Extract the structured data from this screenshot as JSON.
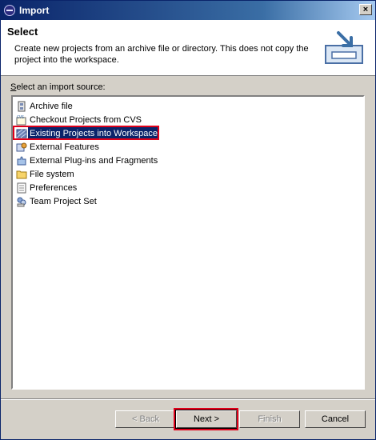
{
  "window": {
    "title": "Import",
    "close_label": "×"
  },
  "header": {
    "title": "Select",
    "description": "Create new projects from an archive file or directory. This does not copy the project into the workspace."
  },
  "source_list": {
    "label_prefix": "S",
    "label_rest": "elect an import source:",
    "items": [
      {
        "label": "Archive file",
        "icon": "archive-file-icon"
      },
      {
        "label": "Checkout Projects from CVS",
        "icon": "cvs-icon"
      },
      {
        "label": "Existing Projects into Workspace",
        "icon": "existing-projects-icon",
        "selected": true
      },
      {
        "label": "External Features",
        "icon": "external-features-icon"
      },
      {
        "label": "External Plug-ins and Fragments",
        "icon": "plugin-icon"
      },
      {
        "label": "File system",
        "icon": "folder-icon"
      },
      {
        "label": "Preferences",
        "icon": "preferences-icon"
      },
      {
        "label": "Team Project Set",
        "icon": "team-project-icon"
      }
    ]
  },
  "buttons": {
    "back": "< Back",
    "next": "Next >",
    "finish": "Finish",
    "cancel": "Cancel"
  },
  "colors": {
    "selection": "#0a246a",
    "highlight_box": "#e0001a"
  }
}
